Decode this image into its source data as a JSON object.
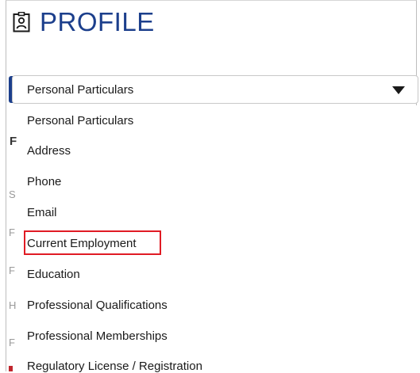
{
  "header": {
    "title": "PROFILE",
    "icon": "id-badge-icon"
  },
  "section_select": {
    "selected": "Personal Particulars",
    "icon": "caret-down-icon",
    "options": [
      "Personal Particulars",
      "Address",
      "Phone",
      "Email",
      "Current Employment",
      "Education",
      "Professional Qualifications",
      "Professional Memberships",
      "Regulatory License / Registration"
    ]
  },
  "background_letters": [
    "F",
    "S",
    "F",
    "F",
    "H",
    "F"
  ],
  "colors": {
    "accent": "#1c3f8c",
    "highlight_box": "#e01b24",
    "red_marker": "#c0262d"
  }
}
